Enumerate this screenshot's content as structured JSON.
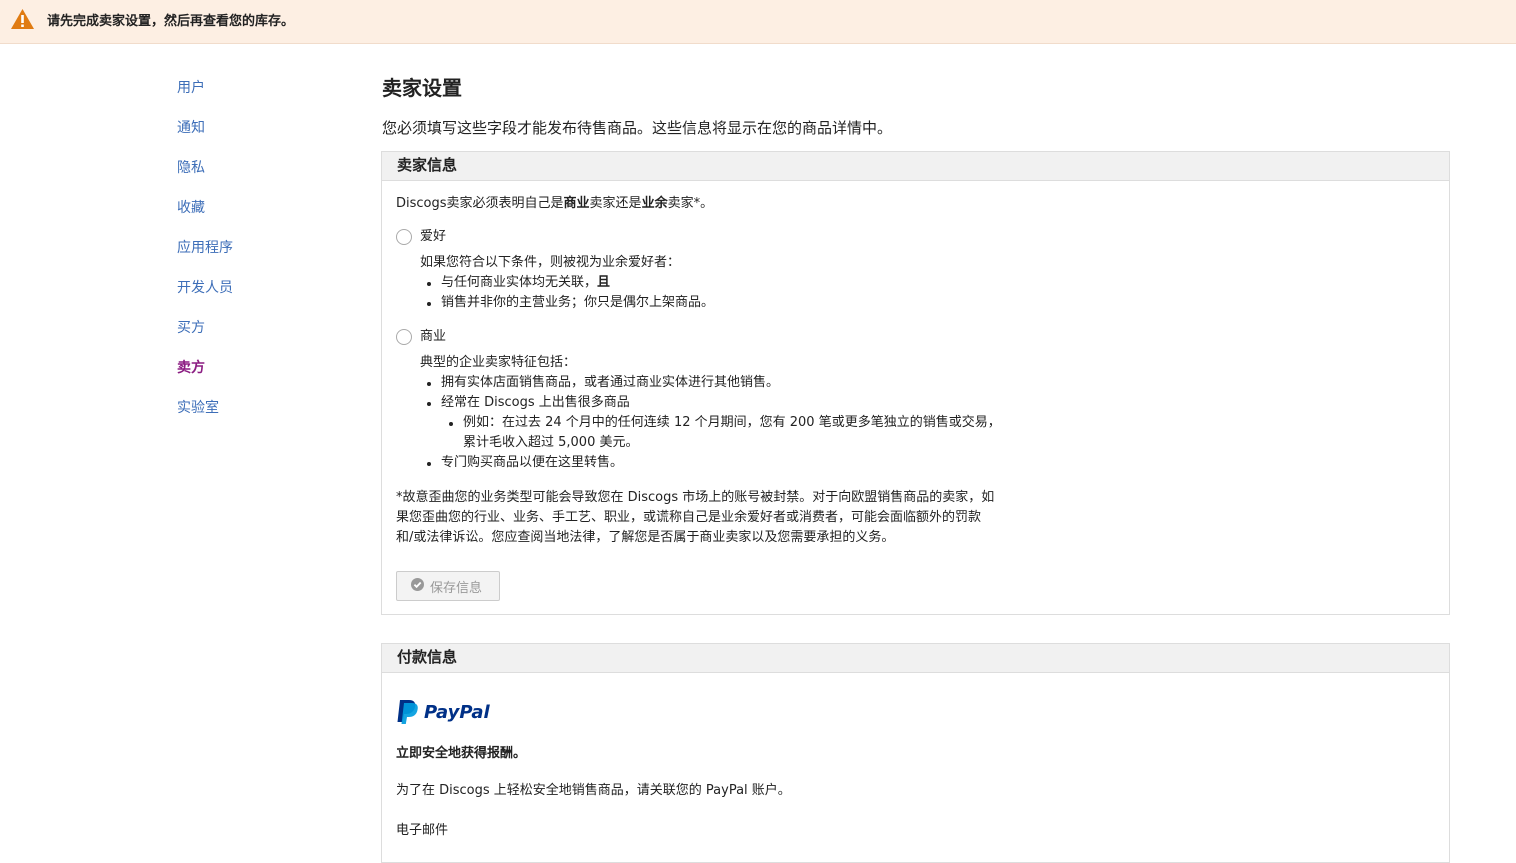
{
  "alert": {
    "text": "请先完成卖家设置，然后再查看您的库存。",
    "icon": "warning-icon",
    "color": "#e07b12"
  },
  "sidebar": {
    "items": [
      {
        "label": "用户"
      },
      {
        "label": "通知"
      },
      {
        "label": "隐私"
      },
      {
        "label": "收藏"
      },
      {
        "label": "应用程序"
      },
      {
        "label": "开发人员"
      },
      {
        "label": "买方"
      },
      {
        "label": "卖方",
        "active": true
      },
      {
        "label": "实验室"
      }
    ]
  },
  "main": {
    "title": "卖家设置",
    "intro": "您必须填写这些字段才能发布待售商品。这些信息将显示在您的商品详情中。"
  },
  "seller_info": {
    "heading": "卖家信息",
    "prompt_pre": "Discogs卖家必须表明自己是",
    "prompt_b1": "商业",
    "prompt_mid": "卖家还是",
    "prompt_b2": "业余",
    "prompt_post": "卖家*。",
    "hobby": {
      "label": "爱好",
      "desc": "如果您符合以下条件，则被视为业余爱好者：",
      "b1": "与任何商业实体均无关联，",
      "b1_bold": "且",
      "b2": "销售并非你的主营业务；你只是偶尔上架商品。"
    },
    "business": {
      "label": "商业",
      "desc": "典型的企业卖家特征包括：",
      "b1": "拥有实体店面销售商品，或者通过商业实体进行其他销售。",
      "b2": "经常在 Discogs 上出售很多商品",
      "b2_sub_line1": "例如：在过去 24 个月中的任何连续 12 个月期间，您有 200 笔或更多笔独立的销售或交易，",
      "b2_sub_line2": "累计毛收入超过 5,000 美元。",
      "b3": "专门购买商品以便在这里转售。"
    },
    "disclaimer_line1": "*故意歪曲您的业务类型可能会导致您在 Discogs 市场上的账号被封禁。对于向欧盟销售商品的卖家，如",
    "disclaimer_line2": "果您歪曲您的行业、业务、手工艺、职业，或谎称自己是业余爱好者或消费者，可能会面临额外的罚款",
    "disclaimer_line3": "和/或法律诉讼。您应查阅当地法律，了解您是否属于商业卖家以及您需要承担的义务。",
    "save_label": "保存信息"
  },
  "payment": {
    "heading": "付款信息",
    "logo_text": "PayPal",
    "tagline": "立即安全地获得报酬。",
    "desc": "为了在 Discogs 上轻松安全地销售商品，请关联您的 PayPal 账户。",
    "email_label": "电子邮件"
  }
}
